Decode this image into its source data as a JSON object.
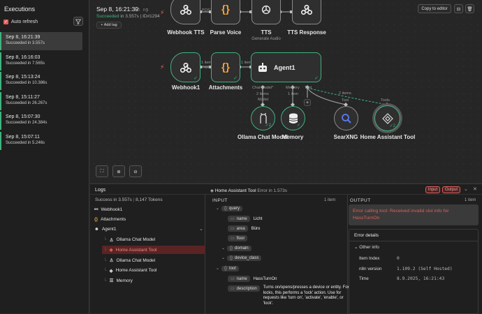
{
  "sidebar": {
    "title": "Executions",
    "auto_refresh": "Auto refresh",
    "executions": [
      {
        "time": "Sep 8, 16:21:39",
        "status": "Succeeded in 3.557s"
      },
      {
        "time": "Sep 8, 16:16:03",
        "status": "Succeeded in 7.565s"
      },
      {
        "time": "Sep 8, 15:13:24",
        "status": "Succeeded in 10.386s"
      },
      {
        "time": "Sep 8, 15:11:27",
        "status": "Succeeded in 26.267s"
      },
      {
        "time": "Sep 8, 15:07:30",
        "status": "Succeeded in 24.384s"
      },
      {
        "time": "Sep 8, 15:07:11",
        "status": "Succeeded in 5.246s"
      }
    ]
  },
  "header": {
    "date": "Sep 8, 16:21:39",
    "status": "Succeeded",
    "duration": "in 3.557s",
    "id": "ID#1294",
    "add_tag": "+ Add tag",
    "copy_to_editor": "Copy to editor"
  },
  "nodes": {
    "webhook_tts": "Webhook TTS",
    "parse_voice": "Parse Voice",
    "tts": "TTS",
    "tts_sub": "Generate Audio",
    "tts_response": "TTS Response",
    "webhook1": "Webhook1",
    "attachments": "Attachments",
    "agent1": "Agent1",
    "ollama": "Ollama Chat Model",
    "memory": "Memory",
    "searxng": "SearXNG",
    "hass_tool": "Home Assistant Tool"
  },
  "edges": {
    "post": "POST",
    "one_item": "1 item",
    "two_items": "2 items",
    "chat_model": "Chat Model*",
    "memory": "Memory",
    "tool": "Tool",
    "model": "Model",
    "tools": "Tools"
  },
  "logs": {
    "title": "Logs",
    "summary": "Success in 3.557s",
    "tokens": "8,147 Tokens",
    "items": [
      {
        "label": "Webhook1",
        "level": 0
      },
      {
        "label": "Attachments",
        "level": 0
      },
      {
        "label": "Agent1",
        "level": 0
      },
      {
        "label": "Ollama Chat Model",
        "level": 1
      },
      {
        "label": "Home Assistant Tool",
        "level": 1
      },
      {
        "label": "Ollama Chat Model",
        "level": 1
      },
      {
        "label": "Home Assistant Tool",
        "level": 1
      },
      {
        "label": "Memory",
        "level": 1
      }
    ]
  },
  "detail": {
    "node": "Home Assistant Tool",
    "error_in": "Error in 1.573s",
    "input_btn": "Input",
    "output_btn": "Output",
    "input_header": "INPUT",
    "input_count": "1 item",
    "output_header": "OUTPUT",
    "output_count": "1 item",
    "tree": [
      {
        "key": "query"
      },
      {
        "key": "name",
        "value": "Licht"
      },
      {
        "key": "area",
        "value": "Büro"
      },
      {
        "key": "floor"
      },
      {
        "key": "domain"
      },
      {
        "key": "device_class"
      },
      {
        "key": "tool"
      },
      {
        "key": "name",
        "value": "HassTurnOn"
      },
      {
        "key": "description",
        "value": "Turns on/opens/presses a device or entity. For locks, this performs a 'lock' action. Use for requests like 'turn on', 'activate', 'enable', or 'lock'."
      }
    ],
    "error_message": "Error calling tool: Received invalid slot info for HassTurnOn",
    "error_details": "Error details",
    "other_info": "Other info",
    "fields": [
      {
        "label": "Item Index",
        "value": "0"
      },
      {
        "label": "n8n version",
        "value": "1.109.2 (Self Hosted)"
      },
      {
        "label": "Time",
        "value": "8.9.2025, 16:21:43"
      }
    ]
  },
  "colors": {
    "success": "#3fb27f",
    "error": "#e0605a",
    "node_orange": "#f2a33a"
  }
}
